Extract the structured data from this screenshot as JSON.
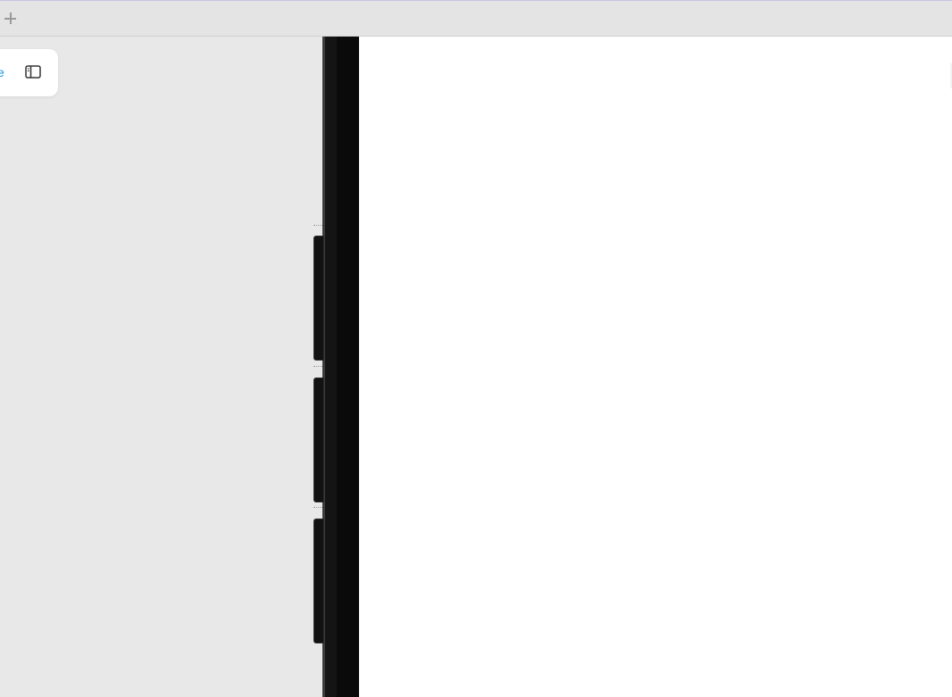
{
  "topbar": {
    "new_tab_icon": "plus-icon"
  },
  "floating_toolbar": {
    "partial_label": "e",
    "toggle_icon": "sidebar-toggle-icon",
    "accent_color": "#1a8fd8"
  },
  "device": {
    "frame_color": "#0a0a0a",
    "screen_color": "#ffffff",
    "side_buttons": 3
  }
}
